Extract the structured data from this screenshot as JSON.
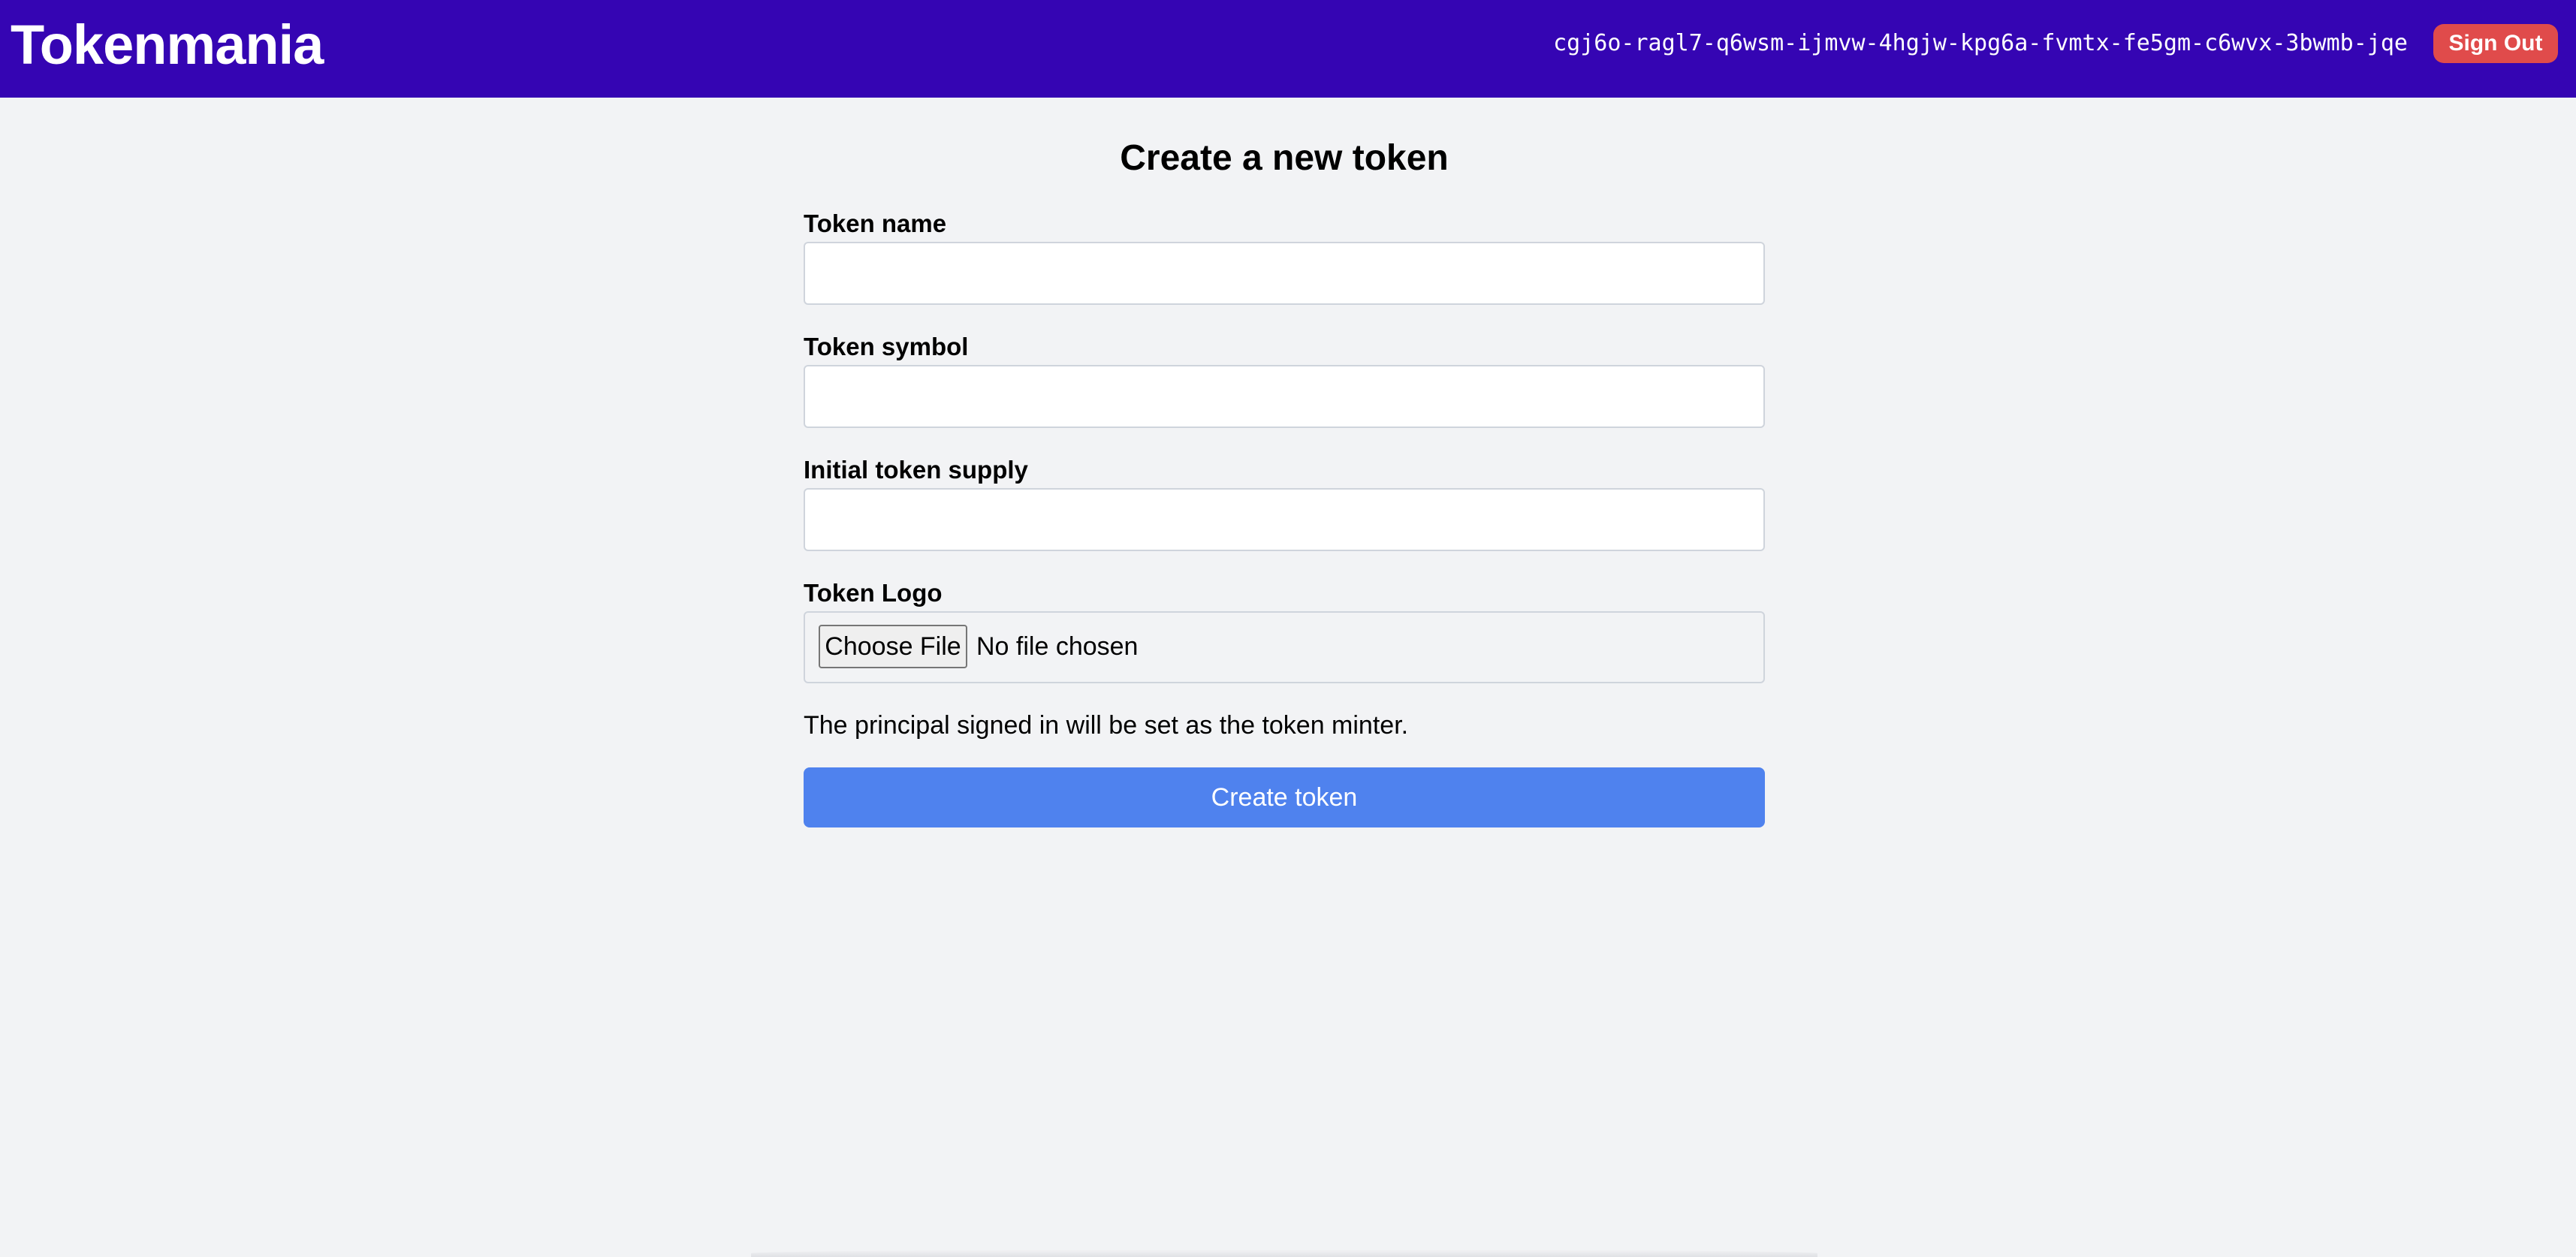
{
  "header": {
    "brand": "Tokenmania",
    "principal": "cgj6o-ragl7-q6wsm-ijmvw-4hgjw-kpg6a-fvmtx-fe5gm-c6wvx-3bwmb-jqe",
    "sign_out_label": "Sign Out"
  },
  "form": {
    "title": "Create a new token",
    "fields": [
      {
        "label": "Token name",
        "value": ""
      },
      {
        "label": "Token symbol",
        "value": ""
      },
      {
        "label": "Initial token supply",
        "value": ""
      }
    ],
    "logo": {
      "label": "Token Logo",
      "choose_label": "Choose File",
      "status": "No file chosen"
    },
    "note": "The principal signed in will be set as the token minter.",
    "submit_label": "Create token"
  },
  "colors": {
    "header_bg": "#3505b3",
    "page_bg": "#f2f3f5",
    "sign_out_bg": "#e04b4b",
    "primary_button": "#4f82ee"
  }
}
